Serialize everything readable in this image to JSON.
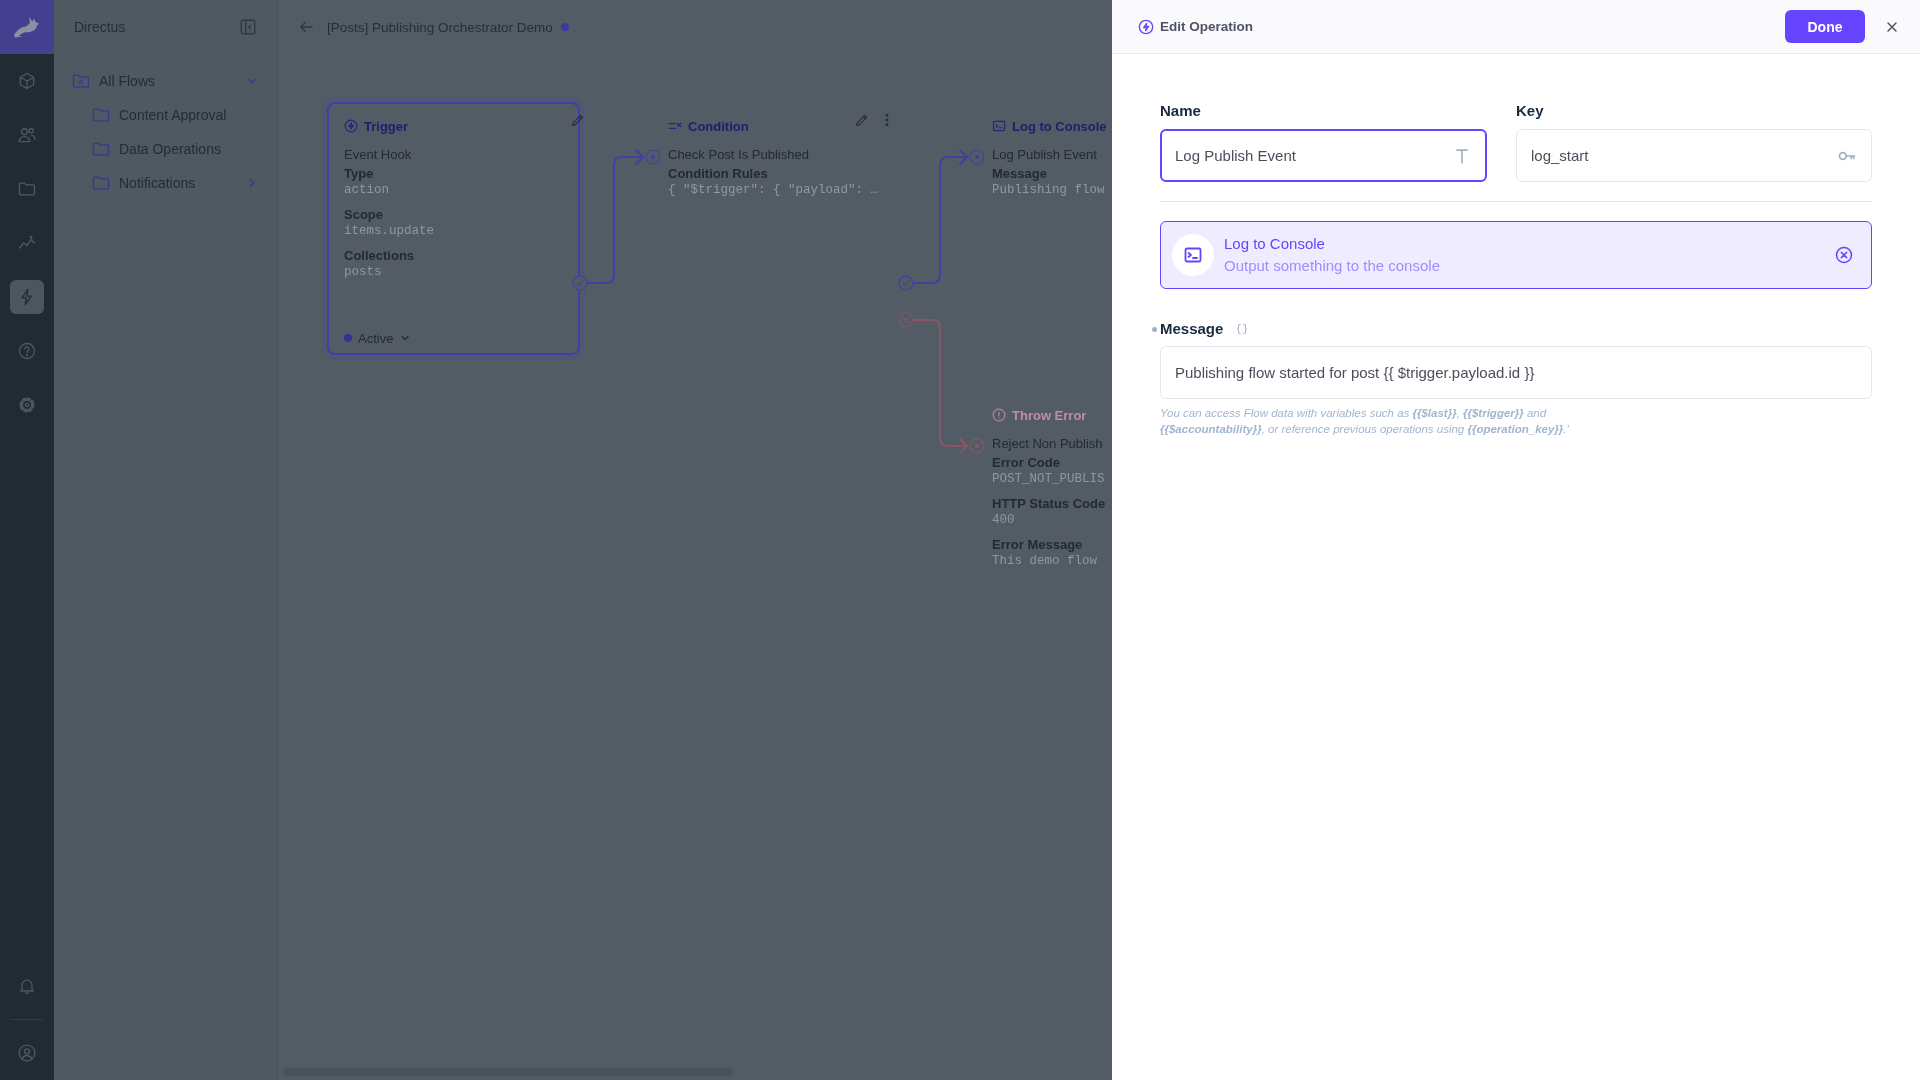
{
  "module_bar": {
    "modules": [
      {
        "kind": "cube",
        "selected": false
      },
      {
        "kind": "users",
        "selected": false
      },
      {
        "kind": "folder",
        "selected": false
      },
      {
        "kind": "chart",
        "selected": false
      },
      {
        "kind": "bolt",
        "selected": true
      },
      {
        "kind": "help",
        "selected": false
      },
      {
        "kind": "gear",
        "selected": false
      }
    ]
  },
  "navigation": {
    "title": "Directus",
    "items": [
      {
        "kind": "root",
        "label": "All Flows",
        "expanded": true,
        "children": [
          {
            "kind": "folder",
            "label": "Content Approval"
          },
          {
            "kind": "folder",
            "label": "Data Operations"
          },
          {
            "kind": "folder",
            "label": "Notifications",
            "expanded": false
          }
        ]
      }
    ]
  },
  "header": {
    "title": "[Posts] Publishing Orchestrator Demo"
  },
  "canvas": {
    "nodes": [
      {
        "kind": "trigger",
        "title": "Trigger",
        "subtitle": "Event Hook",
        "fields": [
          {
            "label": "Type",
            "value": "action"
          },
          {
            "label": "Scope",
            "value": "items.update"
          },
          {
            "label": "Collections",
            "value": "posts"
          }
        ],
        "status": "Active"
      },
      {
        "kind": "condition",
        "title": "Condition",
        "subtitle": "Check Post Is Published",
        "fields": [
          {
            "label": "Condition Rules",
            "value": "{ \"$trigger\": { \"payload\": …"
          }
        ]
      },
      {
        "kind": "log",
        "title": "Log to Console",
        "subtitle": "Log Publish Event",
        "fields": [
          {
            "label": "Message",
            "value": "Publishing flow"
          }
        ]
      },
      {
        "kind": "error",
        "title": "Throw Error",
        "subtitle": "Reject Non Publish",
        "fields": [
          {
            "label": "Error Code",
            "value": "POST_NOT_PUBLIS"
          },
          {
            "label": "HTTP Status Code",
            "value": "400"
          },
          {
            "label": "Error Message",
            "value": "This demo flow"
          }
        ]
      }
    ],
    "connections": [
      {
        "kind": "success"
      },
      {
        "kind": "success"
      },
      {
        "kind": "failure"
      }
    ]
  },
  "drawer": {
    "title": "Edit Operation",
    "done_button": "Done",
    "fields": [
      {
        "kind": "text",
        "label": "Name",
        "value": "Log Publish Event",
        "focused": true
      },
      {
        "kind": "key",
        "label": "Key",
        "value": "log_start",
        "focused": false
      }
    ],
    "operation": {
      "title": "Log to Console",
      "description": "Output something to the console"
    },
    "message": {
      "label": "Message",
      "required": true,
      "value": "Publishing flow started for post {{ $trigger.payload.id }}",
      "hint": "You can access Flow data with variables such as **{{$last}}**, **{{$trigger}}** and **{{$accountability}}**, or reference previous operations using **{{operation_key}}**.'"
    }
  }
}
